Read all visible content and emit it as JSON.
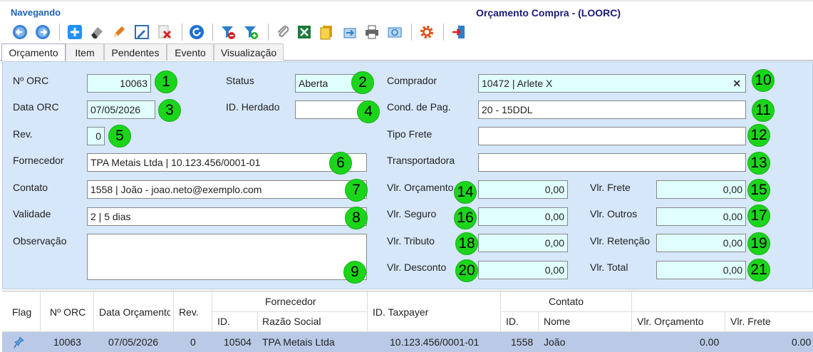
{
  "header": {
    "status": "Navegando",
    "title": "Orçamento Compra - (LOORC)"
  },
  "toolbar": {
    "buttons": [
      {
        "name": "back-icon",
        "color": "#3b82d6"
      },
      {
        "name": "forward-icon",
        "color": "#3b82d6"
      },
      {
        "name": "add-icon",
        "color": "#1e90ff"
      },
      {
        "name": "eraser-icon",
        "color": "#555555"
      },
      {
        "name": "edit-icon",
        "color": "#e07b1a"
      },
      {
        "name": "edit-box-icon",
        "color": "#2e6fb5"
      },
      {
        "name": "delete-icon",
        "color": "#d62020"
      },
      {
        "name": "refresh-icon",
        "color": "#1e6fd6"
      },
      {
        "name": "filter-remove-icon",
        "color": "#2e7fc8"
      },
      {
        "name": "filter-add-icon",
        "color": "#2e7fc8"
      },
      {
        "name": "attachment-icon",
        "color": "#888888"
      },
      {
        "name": "excel-icon",
        "color": "#1d7a3a"
      },
      {
        "name": "copy-icon",
        "color": "#d9a400"
      },
      {
        "name": "export-icon",
        "color": "#2e7fc8"
      },
      {
        "name": "print-icon",
        "color": "#555555"
      },
      {
        "name": "email-icon",
        "color": "#2e7fc8"
      },
      {
        "name": "settings-icon",
        "color": "#e0501a"
      },
      {
        "name": "exit-icon",
        "color": "#d62020"
      }
    ]
  },
  "tabs": [
    "Orçamento",
    "Item",
    "Pendentes",
    "Evento",
    "Visualização"
  ],
  "form": {
    "labels": {
      "n_orc": "Nº ORC",
      "data_orc": "Data ORC",
      "rev": "Rev.",
      "fornecedor": "Fornecedor",
      "contato": "Contato",
      "validade": "Validade",
      "observacao": "Observação",
      "status": "Status",
      "id_herdado": "ID. Herdado",
      "comprador": "Comprador",
      "cond_pag": "Cond. de Pag.",
      "tipo_frete": "Tipo Frete",
      "transportadora": "Transportadora",
      "vlr_orcamento": "Vlr. Orçamento",
      "vlr_seguro": "Vlr. Seguro",
      "vlr_tributo": "Vlr. Tributo",
      "vlr_desconto": "Vlr. Desconto",
      "vlr_frete": "Vlr. Frete",
      "vlr_outros": "Vlr. Outros",
      "vlr_retencao": "Vlr. Retenção",
      "vlr_total": "Vlr. Total"
    },
    "values": {
      "n_orc": "10063",
      "data_orc": "07/05/2026",
      "rev": "0",
      "fornecedor": "TPA Metais Ltda | 10.123.456/0001-01",
      "contato": "1558 | João - joao.neto@exemplo.com",
      "validade": "2 | 5 dias",
      "observacao": "",
      "status": "Aberta",
      "id_herdado": "",
      "comprador": "10472 | Arlete X",
      "cond_pag": "20 - 15DDL",
      "tipo_frete": "",
      "transportadora": "",
      "vlr_orcamento": "0,00",
      "vlr_seguro": "0,00",
      "vlr_tributo": "0,00",
      "vlr_desconto": "0,00",
      "vlr_frete": "0,00",
      "vlr_outros": "0,00",
      "vlr_retencao": "0,00",
      "vlr_total": "0,00"
    },
    "badges": [
      "1",
      "2",
      "3",
      "4",
      "5",
      "6",
      "7",
      "8",
      "9",
      "10",
      "11",
      "12",
      "13",
      "14",
      "15",
      "16",
      "17",
      "18",
      "19",
      "20",
      "21"
    ]
  },
  "grid": {
    "headers": {
      "flag": "Flag",
      "n_orc": "Nº ORC",
      "data_orcamento": "Data Orçamento",
      "rev": "Rev.",
      "fornecedor_group": "Fornecedor",
      "fornecedor_id": "ID.",
      "razao_social": "Razão Social",
      "id_taxpayer": "ID. Taxpayer",
      "contato_group": "Contato",
      "contato_id": "ID.",
      "nome": "Nome",
      "vlr_orcamento": "Vlr. Orçamento",
      "vlr_frete": "Vlr. Frete"
    },
    "rows": [
      {
        "n_orc": "10063",
        "data_orcamento": "07/05/2026",
        "rev": "0",
        "fornecedor_id": "10504",
        "razao_social": "TPA Metais Ltda",
        "id_taxpayer": "10.123.456/0001-01",
        "contato_id": "1558",
        "nome": "João",
        "vlr_orcamento": "0.00",
        "vlr_frete": "0.00"
      }
    ]
  }
}
